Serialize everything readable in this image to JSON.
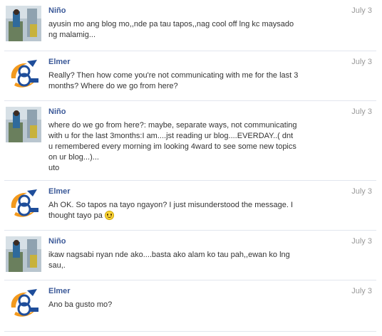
{
  "messages": [
    {
      "sender": "Niño",
      "avatar_icon": "nino-profile-photo-icon",
      "date": "July 3",
      "lines": [
        "ayusin mo ang blog mo,,nde pa tau tapos,,nag cool off lng kc maysado",
        "ng malamig..."
      ]
    },
    {
      "sender": "Elmer",
      "avatar_icon": "elmer-logo-icon",
      "date": "July 3",
      "lines": [
        "Really? Then how come you're not communicating with me for the last 3",
        "months? Where do we go from here?"
      ]
    },
    {
      "sender": "Niño",
      "avatar_icon": "nino-profile-photo-icon",
      "date": "July 3",
      "lines": [
        "where do we go from here?: maybe, separate ways, not communicating",
        "with u for the last 3months:I am....jst reading ur blog....EVERDAY..( dnt",
        "u remembered every morning im looking 4ward to see some new topics",
        "on ur blog...)...",
        "uto"
      ]
    },
    {
      "sender": "Elmer",
      "avatar_icon": "elmer-logo-icon",
      "date": "July 3",
      "lines": [
        "Ah OK. So tapos na tayo ngayon? I just misunderstood the message. I",
        "thought tayo pa"
      ],
      "emoticon": "smiley-icon"
    },
    {
      "sender": "Niño",
      "avatar_icon": "nino-profile-photo-icon",
      "date": "July 3",
      "lines": [
        "ikaw nagsabi nyan nde ako....basta ako alam ko tau pah,,ewan ko lng",
        "sau,."
      ]
    },
    {
      "sender": "Elmer",
      "avatar_icon": "elmer-logo-icon",
      "date": "July 3",
      "lines": [
        "Ano ba gusto mo?"
      ]
    }
  ],
  "colors": {
    "sender_name": "#3b5998",
    "date": "#999999",
    "body_text": "#333333",
    "divider": "#e2e6ee"
  }
}
